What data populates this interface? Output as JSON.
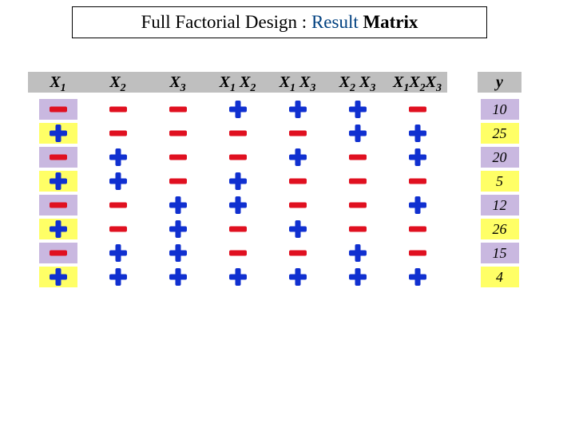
{
  "title": {
    "part1": "Full Factorial Design : ",
    "part2": "Result ",
    "part3": "Matrix"
  },
  "columns": [
    {
      "label_html": "X<sub>1</sub>",
      "highlight": true
    },
    {
      "label_html": "X<sub>2</sub>",
      "highlight": false
    },
    {
      "label_html": "X<sub>3</sub>",
      "highlight": false
    },
    {
      "label_html": "X<sub>1</sub> X<sub>2</sub>",
      "highlight": false
    },
    {
      "label_html": "X<sub>1</sub> X<sub>3</sub>",
      "highlight": false
    },
    {
      "label_html": "X<sub>2</sub> X<sub>3</sub>",
      "highlight": false
    },
    {
      "label_html": "X<sub>1</sub>X<sub>2</sub>X<sub>3</sub>",
      "highlight": false
    }
  ],
  "y_label": "y",
  "rows": [
    {
      "signs": [
        "-",
        "-",
        "-",
        "+",
        "+",
        "+",
        "-"
      ],
      "y": 10,
      "ybg": "purple"
    },
    {
      "signs": [
        "+",
        "-",
        "-",
        "-",
        "-",
        "+",
        "+"
      ],
      "y": 25,
      "ybg": "yellow"
    },
    {
      "signs": [
        "-",
        "+",
        "-",
        "-",
        "+",
        "-",
        "+"
      ],
      "y": 20,
      "ybg": "purple"
    },
    {
      "signs": [
        "+",
        "+",
        "-",
        "+",
        "-",
        "-",
        "-"
      ],
      "y": 5,
      "ybg": "yellow"
    },
    {
      "signs": [
        "-",
        "-",
        "+",
        "+",
        "-",
        "-",
        "+"
      ],
      "y": 12,
      "ybg": "purple"
    },
    {
      "signs": [
        "+",
        "-",
        "+",
        "-",
        "+",
        "-",
        "-"
      ],
      "y": 26,
      "ybg": "yellow"
    },
    {
      "signs": [
        "-",
        "+",
        "+",
        "-",
        "-",
        "+",
        "-"
      ],
      "y": 15,
      "ybg": "purple"
    },
    {
      "signs": [
        "+",
        "+",
        "+",
        "+",
        "+",
        "+",
        "+"
      ],
      "y": 4,
      "ybg": "yellow"
    }
  ],
  "chart_data": {
    "type": "table",
    "title": "Full Factorial Design : Result Matrix",
    "columns": [
      "X1",
      "X2",
      "X3",
      "X1X2",
      "X1X3",
      "X2X3",
      "X1X2X3",
      "y"
    ],
    "data": [
      [
        "-",
        "-",
        "-",
        "+",
        "+",
        "+",
        "-",
        10
      ],
      [
        "+",
        "-",
        "-",
        "-",
        "-",
        "+",
        "+",
        25
      ],
      [
        "-",
        "+",
        "-",
        "-",
        "+",
        "-",
        "+",
        20
      ],
      [
        "+",
        "+",
        "-",
        "+",
        "-",
        "-",
        "-",
        5
      ],
      [
        "-",
        "-",
        "+",
        "+",
        "-",
        "-",
        "+",
        12
      ],
      [
        "+",
        "-",
        "+",
        "-",
        "+",
        "-",
        "-",
        26
      ],
      [
        "-",
        "+",
        "+",
        "-",
        "-",
        "+",
        "-",
        15
      ],
      [
        "+",
        "+",
        "+",
        "+",
        "+",
        "+",
        "+",
        4
      ]
    ]
  }
}
